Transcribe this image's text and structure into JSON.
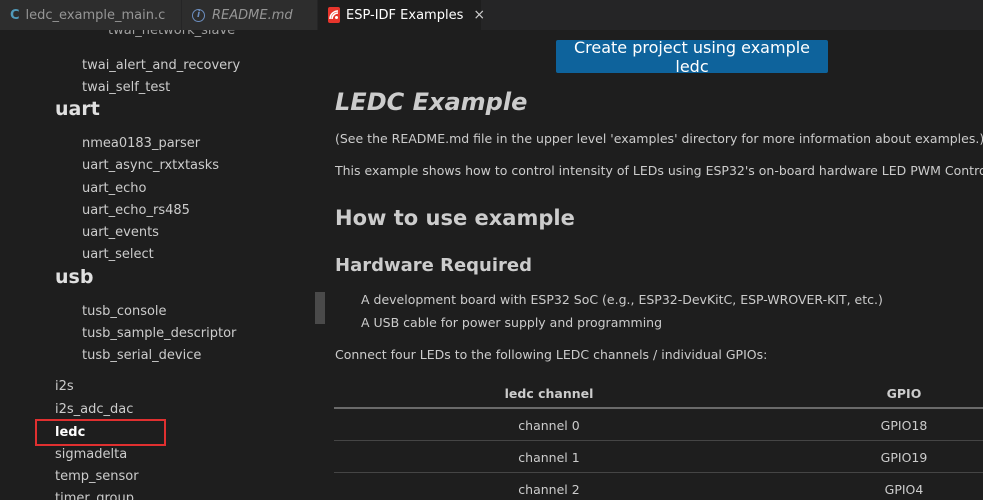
{
  "tabs": [
    {
      "label": "ledc_example_main.c",
      "icon": "c-file-icon"
    },
    {
      "label": "README.md",
      "icon": "info-icon"
    },
    {
      "label": "ESP-IDF Examples",
      "icon": "esp-idf-icon",
      "close": "×"
    }
  ],
  "sidebar": {
    "partial_top": "twai_network_slave",
    "twai_items": [
      "twai_alert_and_recovery",
      "twai_self_test"
    ],
    "uart_title": "uart",
    "uart_items": [
      "nmea0183_parser",
      "uart_async_rxtxtasks",
      "uart_echo",
      "uart_echo_rs485",
      "uart_events",
      "uart_select"
    ],
    "usb_title": "usb",
    "usb_items": [
      "tusb_console",
      "tusb_sample_descriptor",
      "tusb_serial_device"
    ],
    "periph_items": [
      "i2s",
      "i2s_adc_dac",
      "ledc",
      "sigmadelta",
      "temp_sensor",
      "timer_group"
    ],
    "selected": "ledc"
  },
  "main": {
    "create_button": "Create project using example ledc",
    "title": "LEDC Example",
    "note": "(See the README.md file in the upper level 'examples' directory for more information about examples.)",
    "description": "This example shows how to control intensity of LEDs using ESP32's on-board hardware LED PWM Controller mo",
    "how_to_title": "How to use example",
    "hw_title": "Hardware Required",
    "hw_items": [
      "A development board with ESP32 SoC (e.g., ESP32-DevKitC, ESP-WROVER-KIT, etc.)",
      "A USB cable for power supply and programming"
    ],
    "connect_text": "Connect four LEDs to the following LEDC channels / individual GPIOs:",
    "table": {
      "headers": [
        "ledc channel",
        "GPIO"
      ],
      "rows": [
        [
          "channel 0",
          "GPIO18"
        ],
        [
          "channel 1",
          "GPIO19"
        ],
        [
          "channel 2",
          "GPIO4"
        ]
      ]
    }
  },
  "colors": {
    "button_bg": "#0e639c",
    "selection_border": "#e03030",
    "esp_icon": "#e7352c"
  }
}
